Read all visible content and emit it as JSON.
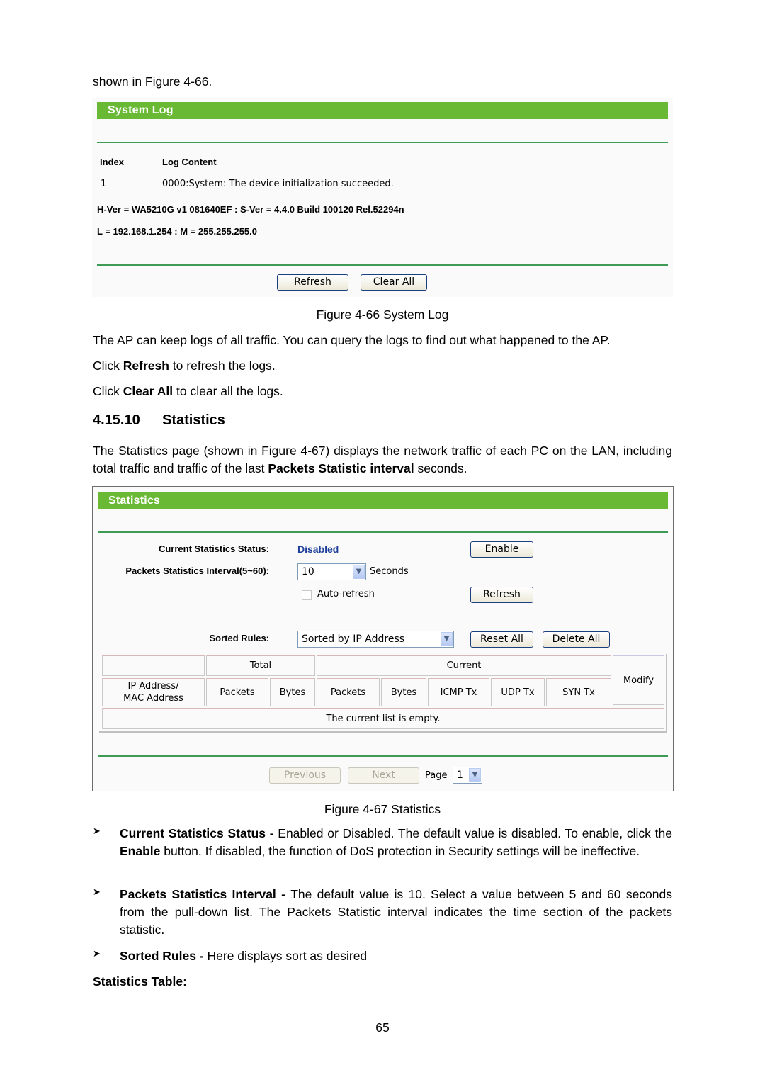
{
  "intro_text": "shown in Figure 4-66.",
  "system_log": {
    "title": "System Log",
    "columns": [
      "Index",
      "Log Content"
    ],
    "rows": [
      {
        "index": "1",
        "content": "0000:System: The device initialization succeeded."
      }
    ],
    "hw_info": "H-Ver = WA5210G v1 081640EF : S-Ver = 4.4.0 Build 100120 Rel.52294n",
    "lan_info": "L = 192.168.1.254 : M = 255.255.255.0",
    "buttons": {
      "refresh": "Refresh",
      "clear_all": "Clear All"
    }
  },
  "figure_66_caption": "Figure 4-66 System Log",
  "para_ap": "The AP can keep logs of all traffic. You can query the logs to find out what happened to the AP.",
  "para_refresh": {
    "pre": "Click ",
    "bold": "Refresh",
    "post": " to refresh the logs."
  },
  "para_clear": {
    "pre": "Click ",
    "bold": "Clear All",
    "post": " to clear all the logs."
  },
  "section": {
    "number": "4.15.10",
    "title": "Statistics"
  },
  "para_stats": {
    "pre": "The Statistics page (shown in Figure 4-67) displays the network traffic of each PC on the LAN, including total traffic and traffic of the last ",
    "bold": "Packets Statistic interval",
    "post": " seconds."
  },
  "statistics": {
    "title": "Statistics",
    "status_label": "Current Statistics Status:",
    "status_value": "Disabled",
    "status_color": "#1d3f9a",
    "interval_label": "Packets Statistics Interval(5~60):",
    "interval_value": "10",
    "interval_unit": "Seconds",
    "auto_refresh_label": "Auto-refresh",
    "auto_refresh_checked": false,
    "sorted_rules_label": "Sorted Rules:",
    "sorted_rules_value": "Sorted by IP Address",
    "buttons": {
      "enable": "Enable",
      "refresh": "Refresh",
      "reset_all": "Reset All",
      "delete_all": "Delete All",
      "previous": "Previous",
      "next": "Next"
    },
    "table": {
      "group_total": "Total",
      "group_current": "Current",
      "col_ip": "IP Address/\nMAC Address",
      "col_ip_line1": "IP Address/",
      "col_ip_line2": "MAC Address",
      "col_modify": "Modify",
      "sub_columns": [
        "Packets",
        "Bytes",
        "Packets",
        "Bytes",
        "ICMP Tx",
        "UDP Tx",
        "SYN Tx"
      ],
      "empty_message": "The current list is empty."
    },
    "page_label": "Page",
    "page_value": "1"
  },
  "figure_67_caption": "Figure 4-67 Statistics",
  "bullets": [
    {
      "bold": "Current Statistics Status - ",
      "pre": "Enabled or Disabled. The default value is disabled. To enable, click the ",
      "bold2": "Enable",
      "post": " button. If disabled, the function of DoS protection in Security settings will be ineffective."
    },
    {
      "bold": "Packets Statistics Interval - ",
      "pre": "The default value is 10. Select a value between 5 and 60 seconds from the pull-down list. The Packets Statistic interval indicates the time section of the packets statistic."
    },
    {
      "bold": "Sorted Rules - ",
      "pre": "Here displays sort as desired"
    }
  ],
  "stats_table_heading": "Statistics Table:",
  "page_number": "65"
}
